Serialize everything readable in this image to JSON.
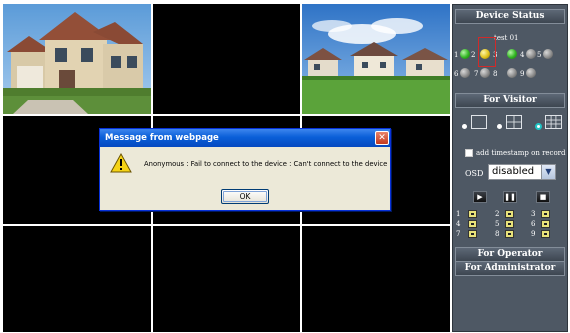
{
  "panel": {
    "device_status_title": "Device Status",
    "device_name": "test 01",
    "channels": [
      {
        "label": "1",
        "status": "green"
      },
      {
        "label": "2",
        "status": "yellow"
      },
      {
        "label": "3",
        "status": "green"
      },
      {
        "label": "4",
        "status": "gray"
      },
      {
        "label": "5",
        "status": "gray"
      },
      {
        "label": "6",
        "status": "gray"
      },
      {
        "label": "7",
        "status": "gray"
      },
      {
        "label": "8",
        "status": "gray"
      },
      {
        "label": "9",
        "status": "gray"
      }
    ],
    "for_visitor_title": "For Visitor",
    "add_timestamp_label": "add timestamp on record",
    "osd_label": "OSD",
    "osd_value": "disabled",
    "playback_buttons": [
      "▶",
      "❚❚",
      "■"
    ],
    "ptz_numbers": [
      "1",
      "2",
      "3",
      "4",
      "5",
      "6",
      "7",
      "8",
      "9"
    ],
    "for_operator_title": "For Operator",
    "for_administrator_title": "For Administrator"
  },
  "dialog": {
    "title": "Message from webpage",
    "message": "Anonymous : Fail to connect to the device : Can't connect to the device",
    "ok_label": "OK",
    "close_glyph": "✕"
  },
  "colors": {
    "panel_bg": "#4e5864",
    "dialog_title": "#0a5fd8",
    "status_green": "#31b521",
    "status_yellow": "#e0c21a",
    "status_gray": "#8c8c8c",
    "selection_outline": "#d02a2a"
  },
  "icons": {
    "warning": "warning-icon",
    "close": "close-icon",
    "layout_1": "layout-single-icon",
    "layout_4": "layout-quad-icon",
    "layout_9": "layout-nine-icon"
  }
}
